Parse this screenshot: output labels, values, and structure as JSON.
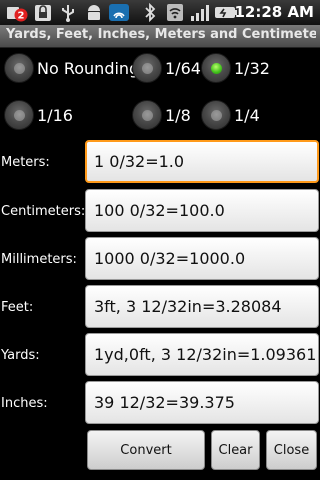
{
  "statusbar": {
    "notification_count": "2",
    "time": "12:28 AM",
    "icons": [
      "notification-badge-icon",
      "lock-icon",
      "usb-icon",
      "android-icon",
      "wifi-hotspot-icon",
      "bluetooth-icon",
      "wifi-icon",
      "signal-icon",
      "battery-icon"
    ]
  },
  "app": {
    "title": "Yards, Feet, Inches, Meters and Centimeter..."
  },
  "rounding": {
    "options": [
      {
        "label": "No Rounding",
        "checked": false
      },
      {
        "label": "1/64",
        "checked": false
      },
      {
        "label": "1/32",
        "checked": true
      },
      {
        "label": "1/16",
        "checked": false
      },
      {
        "label": "1/8",
        "checked": false
      },
      {
        "label": "1/4",
        "checked": false
      }
    ]
  },
  "fields": [
    {
      "label": "Meters:",
      "value": "1 0/32=1.0"
    },
    {
      "label": "Centimeters:",
      "value": "100 0/32=100.0"
    },
    {
      "label": "Millimeters:",
      "value": "1000 0/32=1000.0"
    },
    {
      "label": "Feet:",
      "value": "3ft, 3 12/32in=3.28084"
    },
    {
      "label": "Yards:",
      "value": "1yd,0ft, 3 12/32in=1.09361"
    },
    {
      "label": "Inches:",
      "value": "39 12/32=39.375"
    }
  ],
  "buttons": {
    "convert": "Convert",
    "clear": "Clear",
    "close": "Close"
  },
  "colors": {
    "focus_border": "#ff9a1a",
    "radio_checked": "#3fbf1a"
  }
}
